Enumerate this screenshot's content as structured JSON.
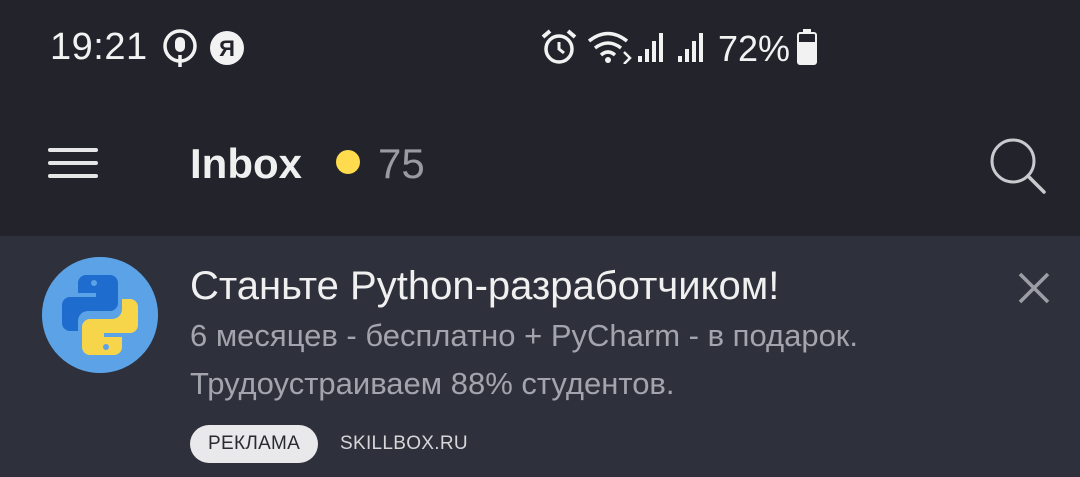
{
  "status_bar": {
    "time": "19:21",
    "battery": "72%",
    "icons": [
      "podcast-icon",
      "yandex-icon",
      "alarm-icon",
      "wifi-icon",
      "signal-icon",
      "signal-icon",
      "battery-icon"
    ],
    "yandex_letter": "Я"
  },
  "header": {
    "menu_icon": "hamburger-menu-icon",
    "title": "Inbox",
    "unread_count": "75",
    "unread_dot_color": "#ffdb4d",
    "search_icon": "search-icon"
  },
  "ad": {
    "title": "Станьте Python-разработчиком!",
    "line1": "6 месяцев - бесплатно + PyCharm - в подарок.",
    "line2": "Трудоустраиваем 88% студентов.",
    "badge": "РЕКЛАМА",
    "domain": "SKILLBOX.RU",
    "avatar": "python-logo-icon",
    "close_icon": "close-icon"
  }
}
